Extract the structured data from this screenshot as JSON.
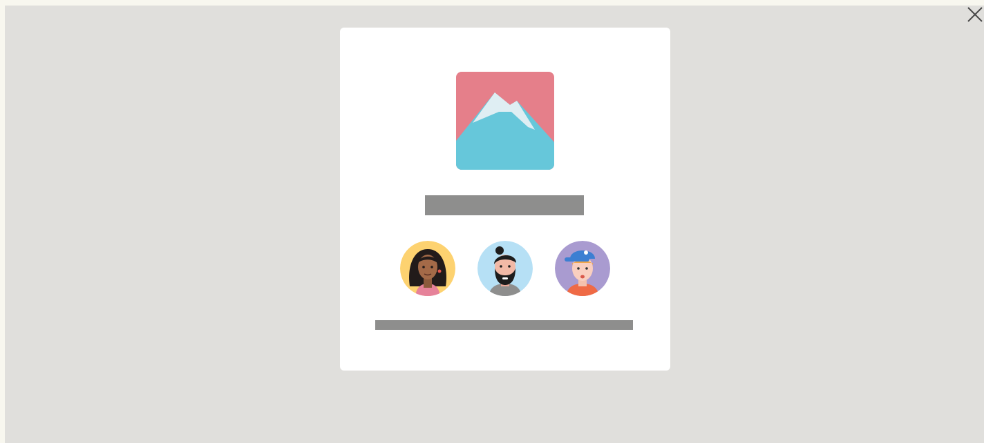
{
  "window": {
    "close_icon": "close-icon"
  },
  "card": {
    "hero_icon": "mountain-image-icon",
    "title_placeholder": "",
    "caption_placeholder": "",
    "avatars": [
      {
        "icon": "avatar-woman-dark-hair-icon",
        "bg_color": "#fdd270"
      },
      {
        "icon": "avatar-man-beard-icon",
        "bg_color": "#b6e0f5"
      },
      {
        "icon": "avatar-man-cap-icon",
        "bg_color": "#a99bd0"
      }
    ]
  },
  "colors": {
    "backdrop": "#e0dfdc",
    "card": "#ffffff",
    "placeholder_bar": "#8e8e8d",
    "hero_sky": "#e57f8a",
    "hero_mountain": "#66c7da",
    "hero_snow": "#dfeef3"
  }
}
